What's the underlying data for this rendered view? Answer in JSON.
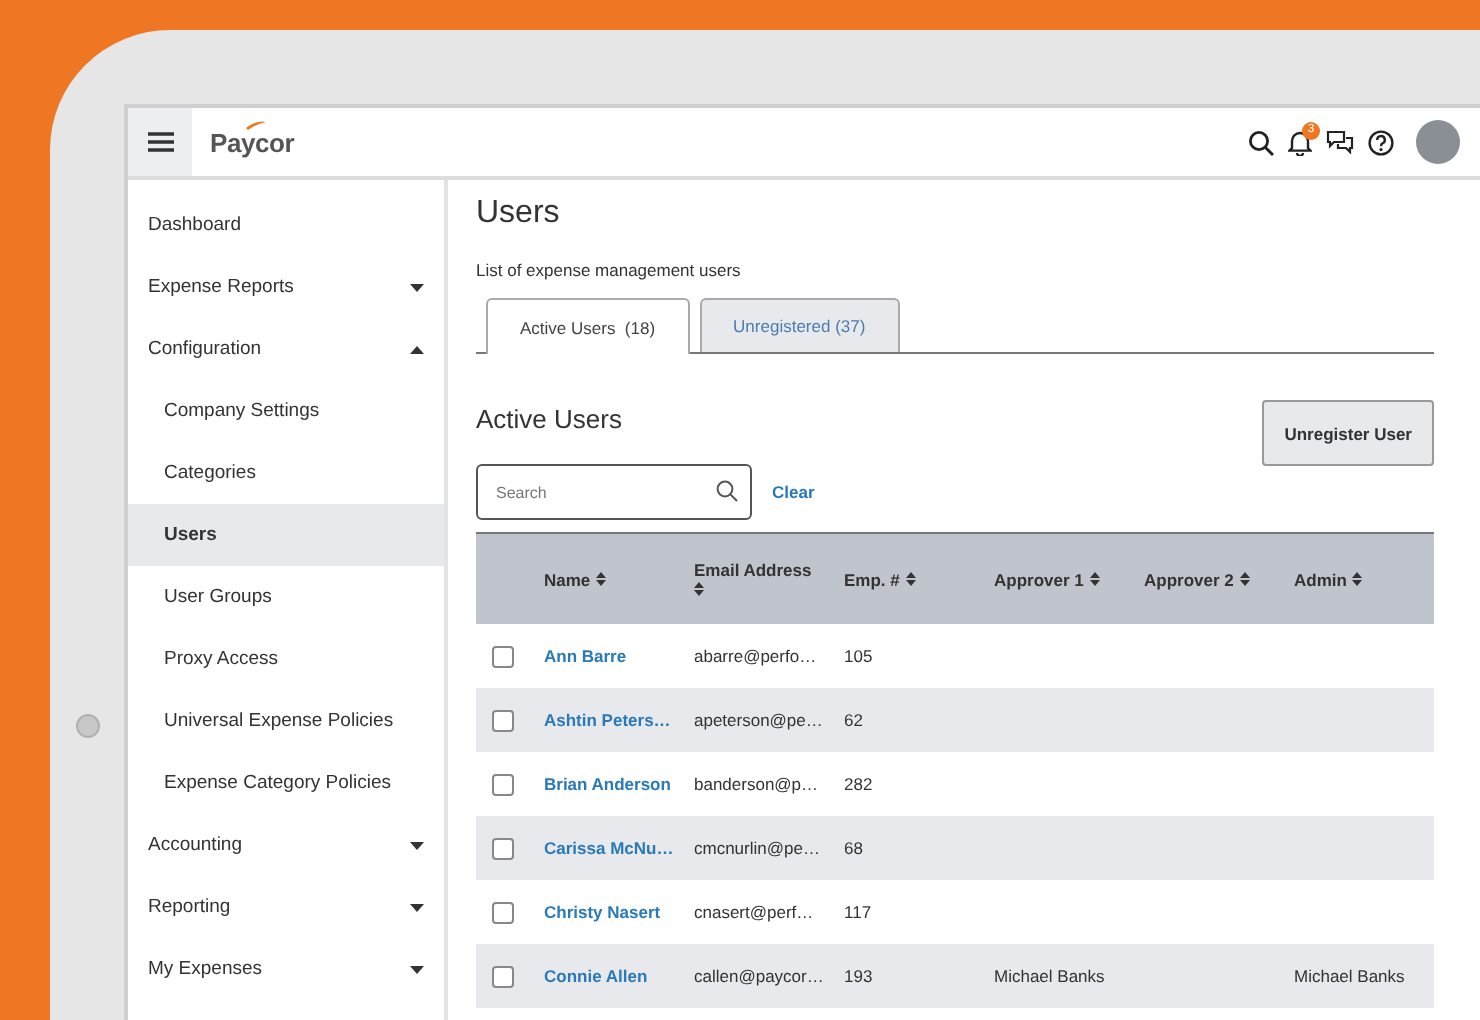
{
  "header": {
    "logo": "Paycor",
    "notification_count": "3"
  },
  "sidebar": {
    "items": [
      {
        "label": "Dashboard",
        "selected": false
      },
      {
        "label": "Expense Reports",
        "selected": false,
        "expanded": false
      },
      {
        "label": "Configuration",
        "selected": false,
        "expanded": true,
        "children": [
          {
            "label": "Company Settings",
            "selected": false
          },
          {
            "label": "Categories",
            "selected": false
          },
          {
            "label": "Users",
            "selected": true
          },
          {
            "label": "User Groups",
            "selected": false
          },
          {
            "label": "Proxy Access",
            "selected": false
          },
          {
            "label": "Universal Expense Policies",
            "selected": false
          },
          {
            "label": "Expense Category Policies",
            "selected": false
          }
        ]
      },
      {
        "label": "Accounting",
        "selected": false,
        "expanded": false
      },
      {
        "label": "Reporting",
        "selected": false,
        "expanded": false
      },
      {
        "label": "My Expenses",
        "selected": false,
        "expanded": false
      }
    ]
  },
  "page": {
    "title": "Users",
    "subtitle": "List of expense management users"
  },
  "tabs": [
    {
      "label": "Active Users  (18)",
      "selected": true
    },
    {
      "label": "Unregistered (37)",
      "selected": false
    }
  ],
  "section_title": "Active Users",
  "unregister_button": "Unregister User",
  "search": {
    "placeholder": "Search"
  },
  "clear_link": "Clear",
  "table": {
    "columns": [
      "Name",
      "Email Address",
      "Emp. #",
      "Approver 1",
      "Approver 2",
      "Admin"
    ],
    "rows": [
      {
        "checked": false,
        "cells": [
          "Ann Barre",
          "abarre@perfo…",
          "105",
          "",
          "",
          ""
        ]
      },
      {
        "checked": false,
        "cells": [
          "Ashtin Peters…",
          "apeterson@pe…",
          "62",
          "",
          "",
          ""
        ]
      },
      {
        "checked": false,
        "cells": [
          "Brian Anderson",
          "banderson@p…",
          "282",
          "",
          "",
          ""
        ]
      },
      {
        "checked": false,
        "cells": [
          "Carissa McNu…",
          "cmcnurlin@pe…",
          "68",
          "",
          "",
          ""
        ]
      },
      {
        "checked": false,
        "cells": [
          "Christy Nasert",
          "cnasert@perf…",
          "117",
          "",
          "",
          ""
        ]
      },
      {
        "checked": false,
        "cells": [
          "Connie Allen",
          "callen@paycor…",
          "193",
          "Michael Banks",
          "",
          "Michael Banks"
        ]
      }
    ]
  }
}
